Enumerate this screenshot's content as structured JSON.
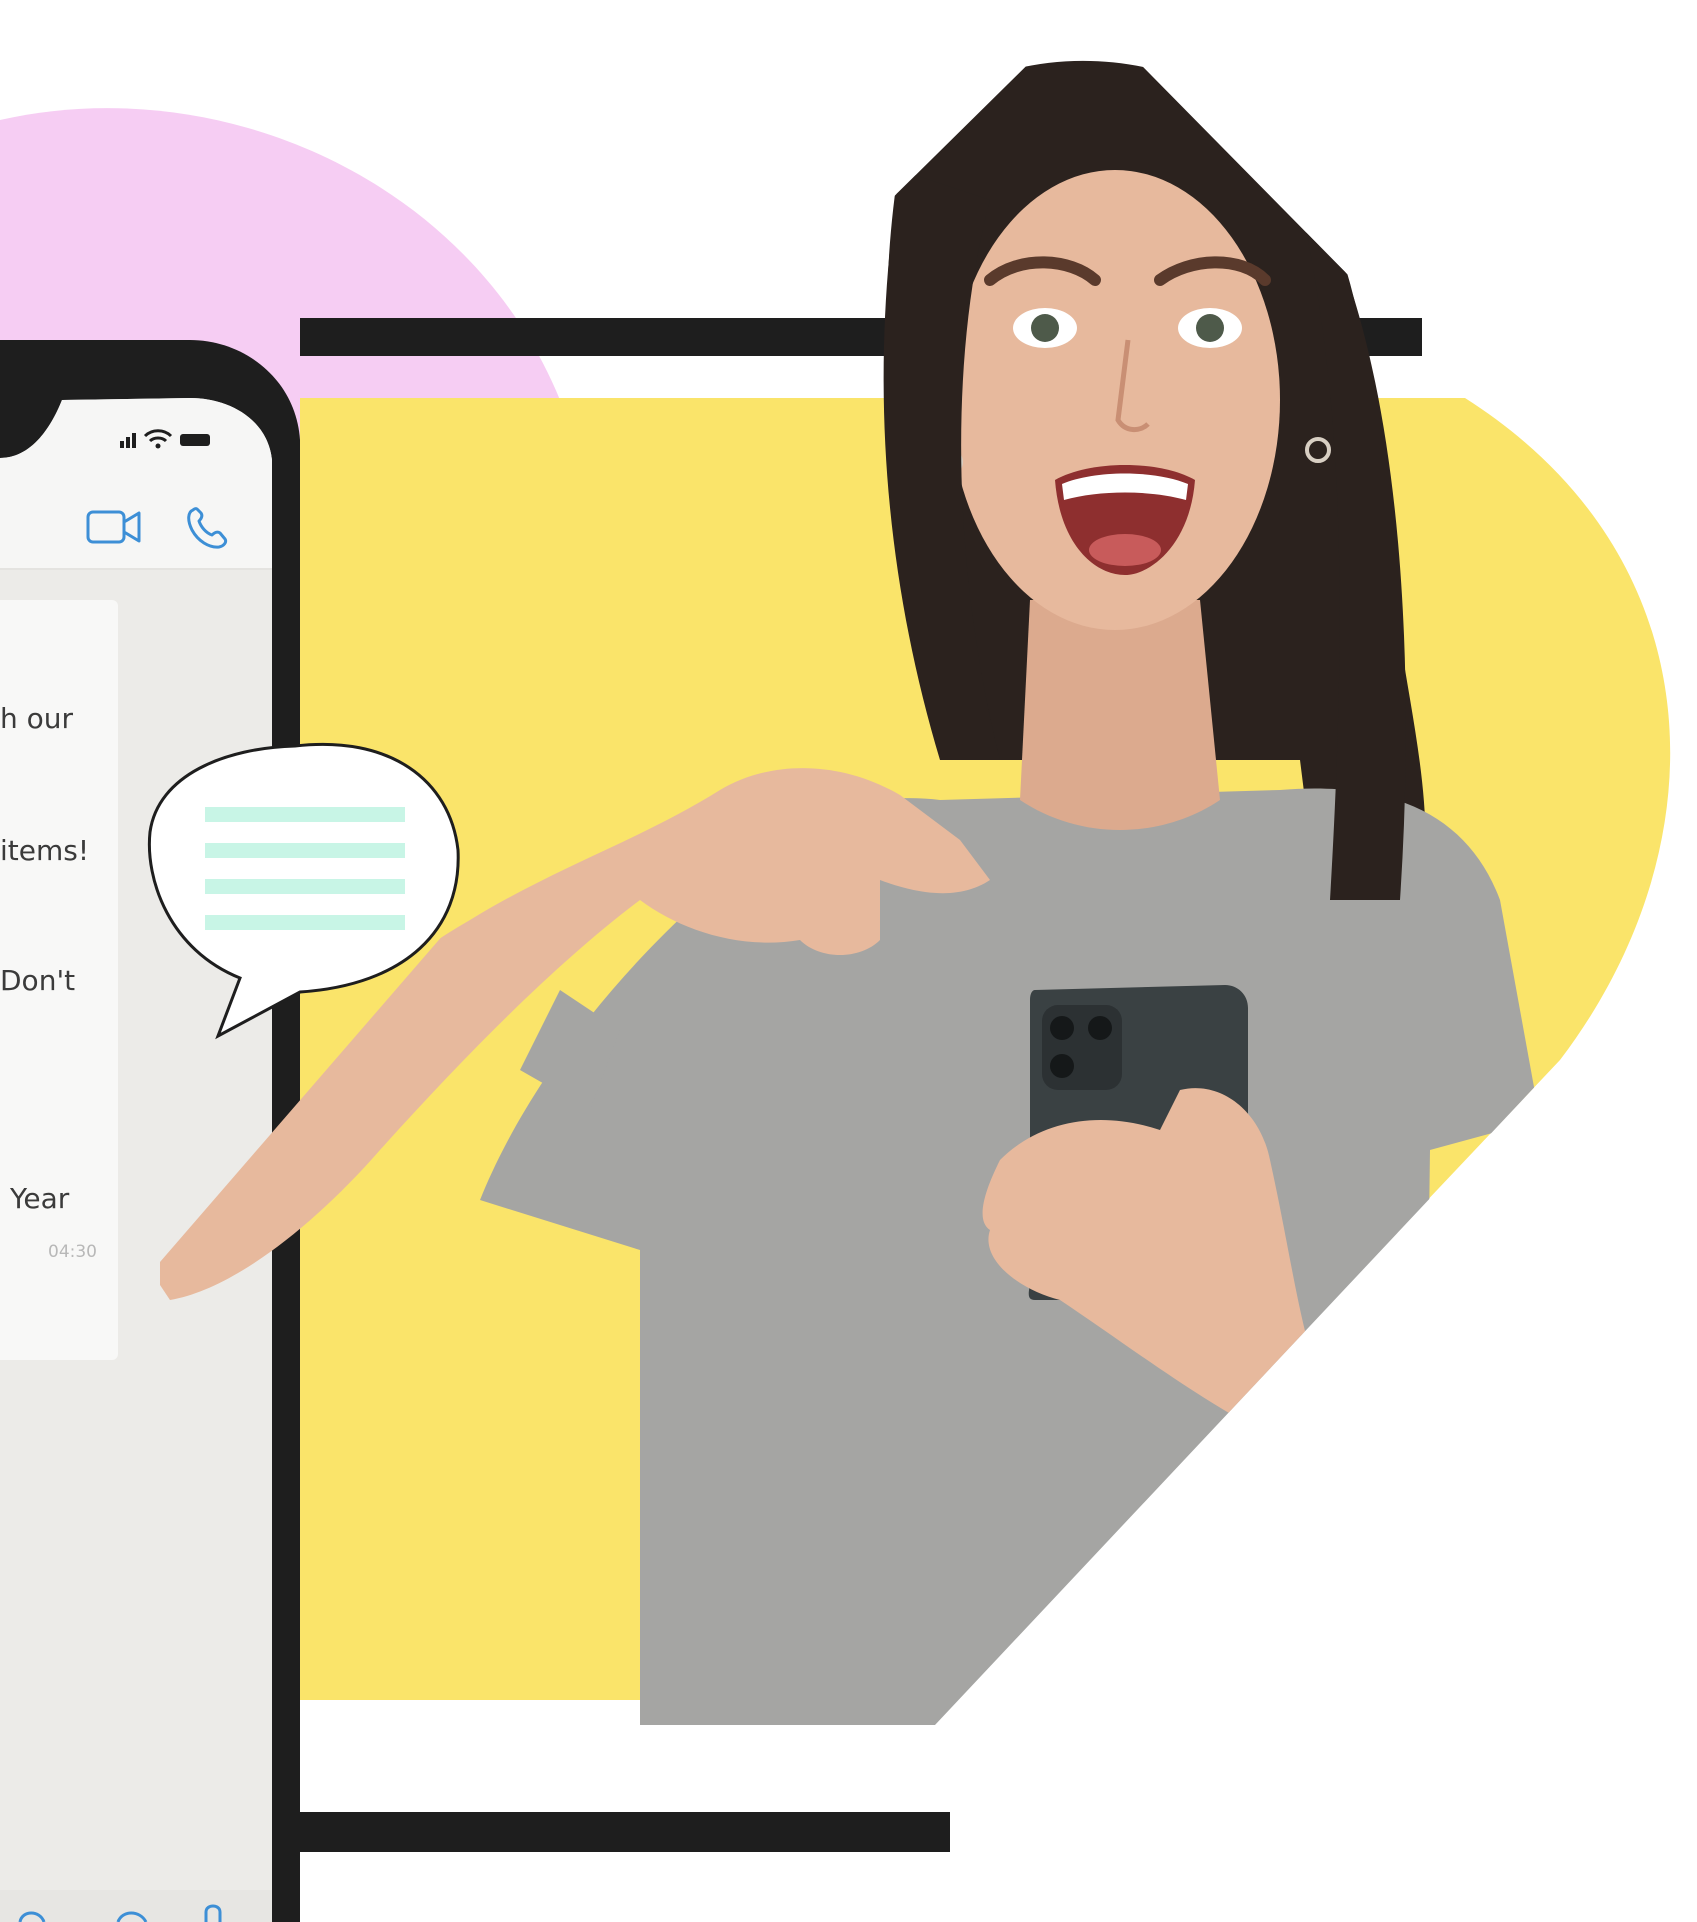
{
  "colors": {
    "background": "#ffffff",
    "pink_blob": "#f6cdf3",
    "yellow_panel": "#fae46a",
    "frame_dark": "#1e1e1e",
    "chat_background": "#ecebe8",
    "message_bubble": "#f8f8f7",
    "header_icon_blue": "#3d8fd6",
    "speech_bubble_lines": "#c8f5e6",
    "shirt_gray": "#a5a5a3",
    "hair_dark": "#2b221e",
    "skin": "#e7b99d"
  },
  "phone": {
    "status_icons": [
      "signal-icon",
      "wifi-icon",
      "battery-icon"
    ],
    "header_icons": [
      "video-call-icon",
      "voice-call-icon"
    ],
    "message": {
      "lines": [
        "h our",
        "items!",
        "Don't",
        "Year"
      ],
      "time": "04:30"
    },
    "bottom_icons": [
      "emoji-icon",
      "camera-icon",
      "mic-icon"
    ]
  },
  "speech_bubble": {
    "line_count": 4
  }
}
